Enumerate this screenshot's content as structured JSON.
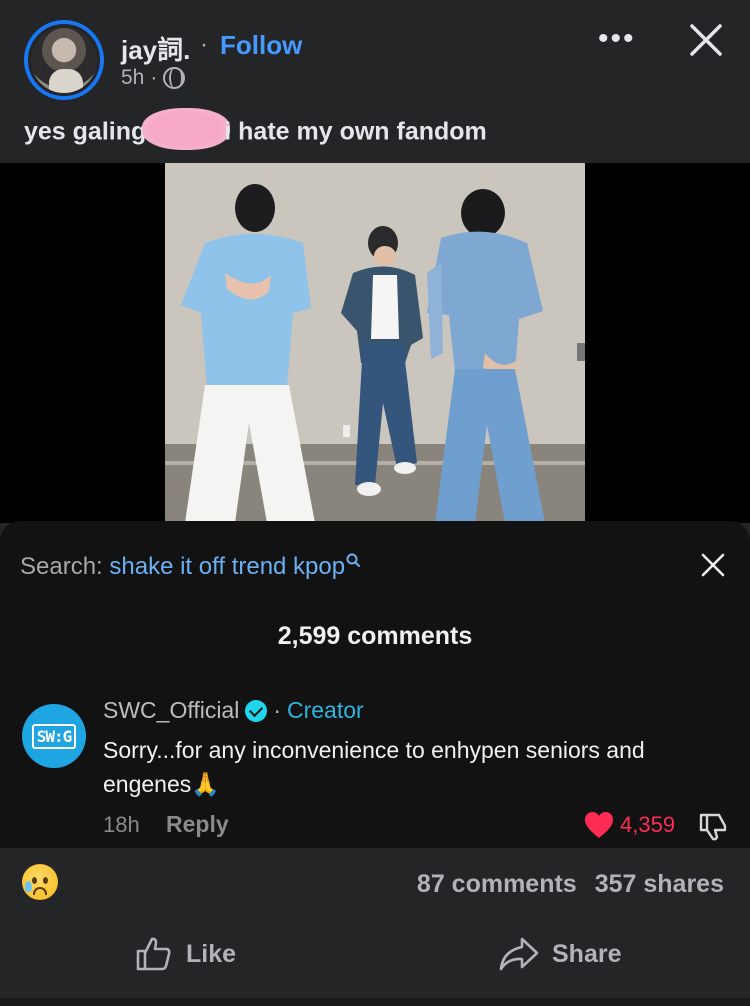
{
  "post": {
    "author": "jay詞.",
    "separator": "·",
    "follow_label": "Follow",
    "time": "5h",
    "time_separator": "·",
    "more_label": "•••",
    "caption_before": "yes galing",
    "caption_after": "i hate my own fandom"
  },
  "overlay": {
    "search_label": "Search: ",
    "search_term": "shake it off trend kpop",
    "comments_count": "2,599 comments",
    "comment": {
      "username": "SWC_Official",
      "separator": "·",
      "creator_label": "Creator",
      "text": "Sorry...for any inconvenience to enhypen seniors and engenes🙏",
      "time": "18h",
      "reply_label": "Reply",
      "likes": "4,359",
      "avatar_text": "SW:G"
    }
  },
  "footer": {
    "comments": "87 comments",
    "shares": "357 shares",
    "like_label": "Like",
    "share_label": "Share"
  },
  "colors": {
    "accent": "#4599ff",
    "creator": "#2fb4e0",
    "heart": "#fe2c55"
  }
}
